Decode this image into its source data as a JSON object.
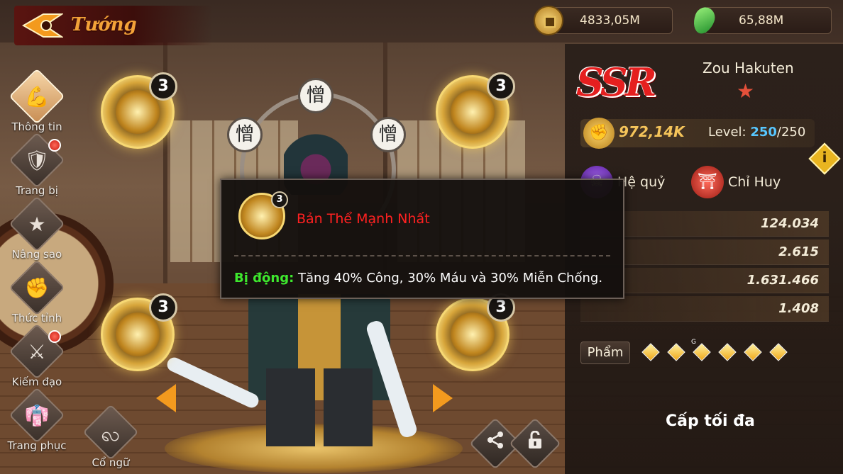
{
  "header": {
    "title": "Tướng",
    "currency": [
      {
        "icon": "coin-icon",
        "value": "4833,05M"
      },
      {
        "icon": "jade-icon",
        "value": "65,88M"
      }
    ]
  },
  "sidebar": {
    "items": [
      {
        "label": "Thông tin",
        "glyph": "💪",
        "active": true,
        "badge": false
      },
      {
        "label": "Trang bị",
        "glyph": "🛡",
        "active": false,
        "badge": true
      },
      {
        "label": "Nâng sao",
        "glyph": "★",
        "active": false,
        "badge": false
      },
      {
        "label": "Thức tỉnh",
        "glyph": "✊",
        "active": false,
        "badge": false
      },
      {
        "label": "Kiếm đạo",
        "glyph": "⚔",
        "active": false,
        "badge": true
      },
      {
        "label": "Trang phục",
        "glyph": "👘",
        "active": false,
        "badge": false
      }
    ],
    "extra": {
      "label": "Cổ ngữ",
      "glyph": "ꩮ"
    }
  },
  "skills": [
    {
      "level": "3"
    },
    {
      "level": "3"
    },
    {
      "level": "3"
    },
    {
      "level": "3"
    }
  ],
  "kanji": [
    "憎",
    "憎",
    "憎"
  ],
  "hero": {
    "rarity": "SSR",
    "name": "Zou Hakuten",
    "power": "972,14K",
    "level_label": "Level:",
    "level_current": "250",
    "level_max": "/250",
    "classes": [
      {
        "label": "Hệ quỷ",
        "color": "#6a2aa0"
      },
      {
        "label": "Chỉ Huy",
        "color": "#c0231c"
      }
    ],
    "stats": [
      "124.034",
      "2.615",
      "1.631.466",
      "1.408"
    ],
    "quality_label": "Phẩm",
    "quality_count": 6,
    "quality_mark": "G",
    "max_level_text": "Cấp tối đa"
  },
  "tooltip": {
    "level": "3",
    "name": "Bản Thể Mạnh Nhất",
    "prefix": "Bị động:",
    "description": " Tăng 40% Công, 30% Máu và 30% Miễn Chống."
  },
  "colors": {
    "accent": "#f39a1e",
    "skill_name": "#ff2121",
    "passive": "#3ee82e",
    "level_current": "#57c7ff"
  }
}
